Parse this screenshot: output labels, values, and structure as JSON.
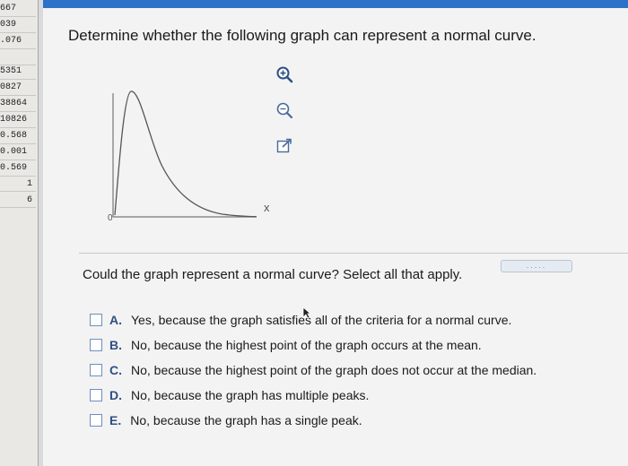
{
  "sheet": {
    "cells": [
      "667",
      "039",
      ".076",
      "",
      "5351",
      "0827",
      "38864",
      "10826",
      "0.568",
      "0.001",
      "0.569",
      "1",
      "6"
    ]
  },
  "question": {
    "title": "Determine whether the following graph can represent a normal curve.",
    "graph": {
      "origin_label": "0",
      "x_label": "x"
    },
    "tools": [
      "zoom-in",
      "zoom-out",
      "open-external"
    ],
    "more_label": ".....",
    "prompt": "Could the graph represent a normal curve? Select all that apply.",
    "options": [
      {
        "letter": "A.",
        "text": "Yes, because the graph satisfies all of the criteria for a normal curve."
      },
      {
        "letter": "B.",
        "text": "No, because the highest point of the graph occurs at the mean."
      },
      {
        "letter": "C.",
        "text": "No, because the highest point of the graph does not occur at the median."
      },
      {
        "letter": "D.",
        "text": "No, because the graph has multiple peaks."
      },
      {
        "letter": "E.",
        "text": "No, because the graph has a single peak."
      }
    ]
  },
  "colors": {
    "accent": "#2e71c8",
    "option_letter": "#2f4f86",
    "checkbox_border": "#6f8fbf"
  }
}
